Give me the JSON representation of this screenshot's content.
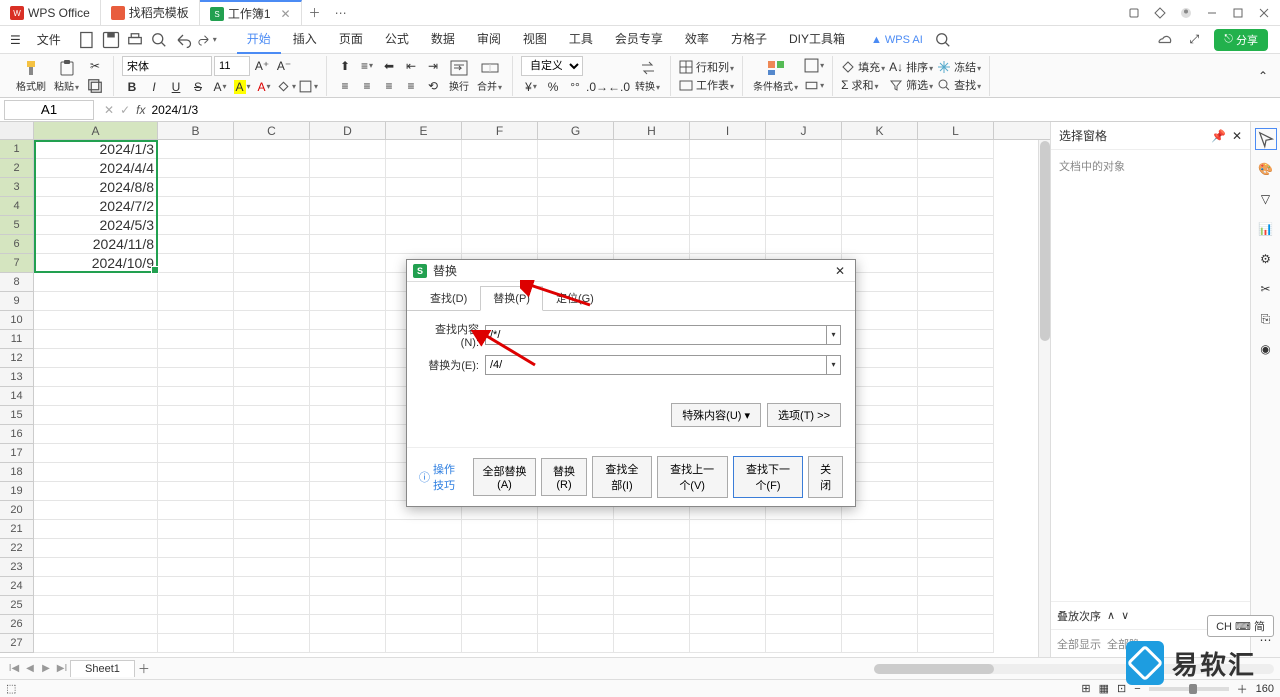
{
  "titlebar": {
    "tabs": [
      {
        "icon": "wps",
        "label": "WPS Office"
      },
      {
        "icon": "doc",
        "label": "找稻壳模板"
      },
      {
        "icon": "sheet",
        "label": "工作簿1"
      }
    ]
  },
  "menubar": {
    "file": "文件",
    "tabs": [
      "开始",
      "插入",
      "页面",
      "公式",
      "数据",
      "审阅",
      "视图",
      "工具",
      "会员专享",
      "效率",
      "方格子",
      "DIY工具箱"
    ],
    "wpsai": "WPS AI",
    "share": "分享"
  },
  "ribbon": {
    "format_brush": "格式刷",
    "paste": "粘贴",
    "font_name": "宋体",
    "font_size": "11",
    "wrap": "换行",
    "merge": "合并",
    "custom": "自定义",
    "convert": "转换",
    "rowcol": "行和列",
    "worksheet": "工作表",
    "cond_format": "条件格式",
    "fill": "填充",
    "sum": "求和",
    "sort": "排序",
    "filter": "筛选",
    "freeze": "冻结",
    "find": "查找"
  },
  "namebox": "A1",
  "formula": "2024/1/3",
  "columns": [
    "A",
    "B",
    "C",
    "D",
    "E",
    "F",
    "G",
    "H",
    "I",
    "J",
    "K",
    "L"
  ],
  "cell_data": [
    "2024/1/3",
    "2024/4/4",
    "2024/8/8",
    "2024/7/2",
    "2024/5/3",
    "2024/11/8",
    "2024/10/9"
  ],
  "taskpane": {
    "title": "选择窗格",
    "body_hint": "文档中的对象",
    "footer_order": "叠放次序",
    "footer_show": "全部显示",
    "footer_hide": "全部隐"
  },
  "sheettab": "Sheet1",
  "dialog": {
    "title": "替换",
    "tabs": [
      "查找(D)",
      "替换(P)",
      "定位(G)"
    ],
    "find_label": "查找内容(N):",
    "find_value": "/*/",
    "replace_label": "替换为(E):",
    "replace_value": "/4/",
    "special": "特殊内容(U)",
    "options": "选项(T) >>",
    "tip": "操作技巧",
    "btn_replace_all": "全部替换(A)",
    "btn_replace": "替换(R)",
    "btn_find_all": "查找全部(I)",
    "btn_find_prev": "查找上一个(V)",
    "btn_find_next": "查找下一个(F)",
    "btn_close": "关闭"
  },
  "status": {
    "zoom": "160",
    "ch": "CH ⌨ 简"
  },
  "watermark": "易软汇"
}
